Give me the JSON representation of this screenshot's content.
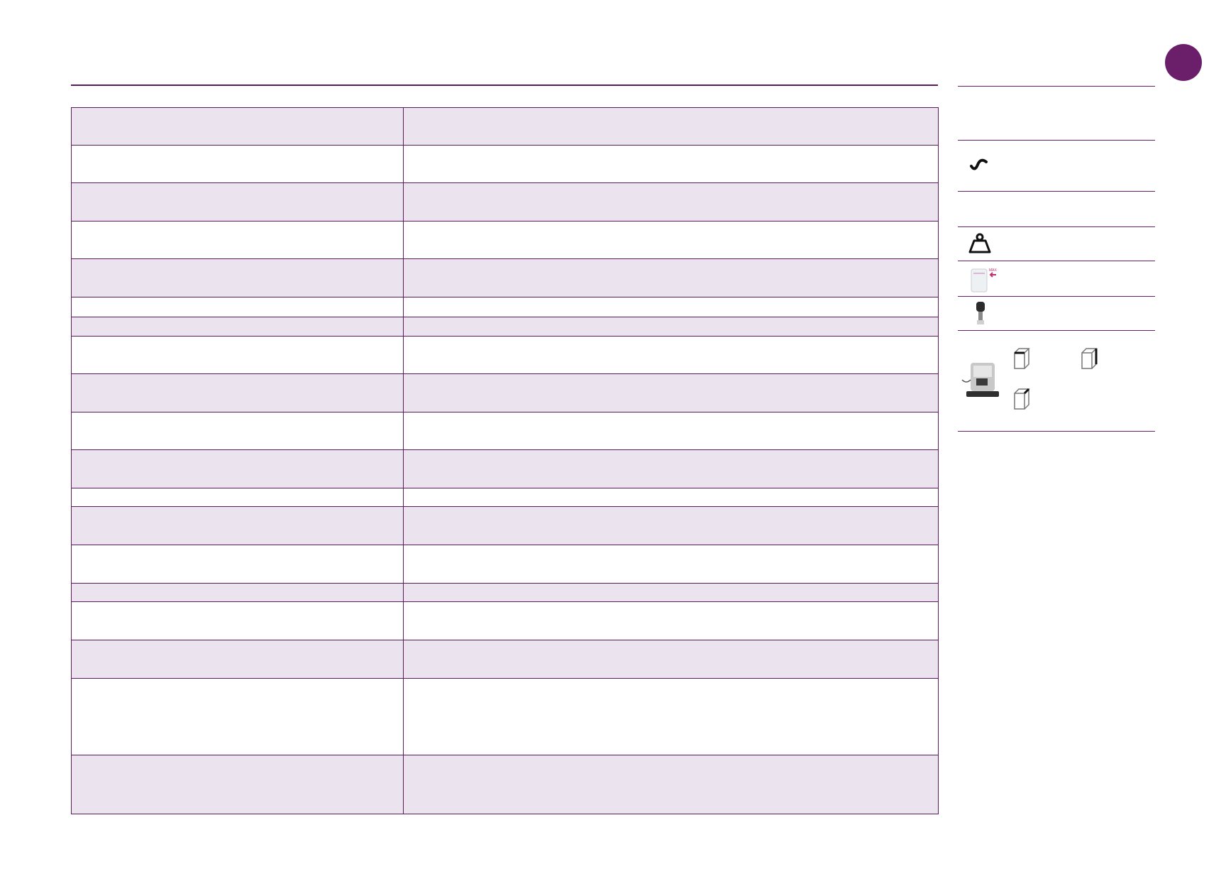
{
  "page": {
    "brand_color": "#6b1f6b",
    "rule_color": "#5c1a5e",
    "row_shade_color": "#ebe4ee"
  },
  "spec_table": {
    "rows": [
      {
        "label": "",
        "value": "",
        "shaded": true
      },
      {
        "label": "",
        "value": "",
        "shaded": false
      },
      {
        "label": "",
        "value": "",
        "shaded": true
      },
      {
        "label": "",
        "value": "",
        "shaded": false
      },
      {
        "label": "",
        "value": "",
        "shaded": true
      },
      {
        "label": "",
        "value": "",
        "shaded": false
      },
      {
        "label": "",
        "value": "",
        "shaded": true
      },
      {
        "label": "",
        "value": "",
        "shaded": false
      },
      {
        "label": "",
        "value": "",
        "shaded": true
      },
      {
        "label": "",
        "value": "",
        "shaded": false
      },
      {
        "label": "",
        "value": "",
        "shaded": true
      },
      {
        "label": "",
        "value": "",
        "shaded": false
      },
      {
        "label": "",
        "value": "",
        "shaded": true
      },
      {
        "label": "",
        "value": "",
        "shaded": false
      },
      {
        "label": "",
        "value": "",
        "shaded": true
      },
      {
        "label": "",
        "value": "",
        "shaded": false
      },
      {
        "label": "",
        "value": "",
        "shaded": true
      },
      {
        "label": "",
        "value": "",
        "shaded": false
      },
      {
        "label": "",
        "value": "",
        "shaded": true
      }
    ]
  },
  "side_panel": {
    "icons": [
      "ac-current-icon",
      "weight-icon",
      "water-tank-max-icon",
      "milk-frother-icon",
      "appliance-photo",
      "box-dimension-icon"
    ],
    "max_label": "MAX"
  }
}
